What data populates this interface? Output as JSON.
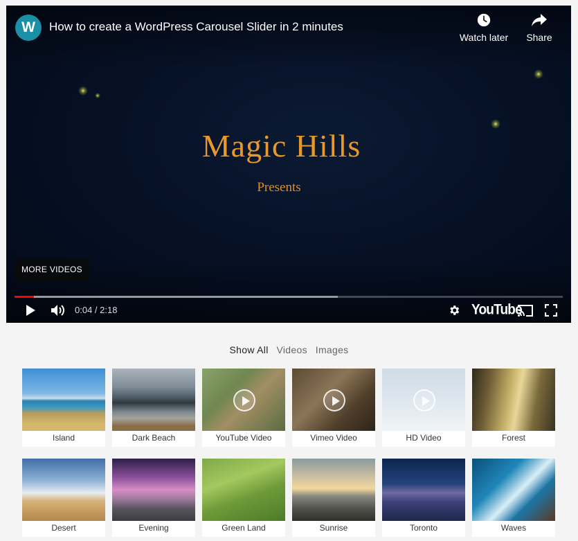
{
  "player": {
    "channel_initial": "W",
    "title": "How to create a WordPress Carousel Slider in 2 minutes",
    "watch_later_label": "Watch later",
    "share_label": "Share",
    "brand_title": "Magic Hills",
    "brand_subtitle": "Presents",
    "more_videos_label": "MORE VIDEOS",
    "time": "0:04 / 2:18",
    "progress_played_fraction": 0.035,
    "progress_loaded_fraction": 0.59,
    "platform_logo": "YouTube"
  },
  "filters": {
    "items": [
      {
        "label": "Show All",
        "active": true
      },
      {
        "label": "Videos",
        "active": false
      },
      {
        "label": "Images",
        "active": false
      }
    ]
  },
  "gallery": {
    "items": [
      {
        "caption": "Island",
        "type": "image"
      },
      {
        "caption": "Dark Beach",
        "type": "image"
      },
      {
        "caption": "YouTube Video",
        "type": "video"
      },
      {
        "caption": "Vimeo Video",
        "type": "video"
      },
      {
        "caption": "HD Video",
        "type": "video"
      },
      {
        "caption": "Forest",
        "type": "image"
      },
      {
        "caption": "Desert",
        "type": "image"
      },
      {
        "caption": "Evening",
        "type": "image"
      },
      {
        "caption": "Green Land",
        "type": "image"
      },
      {
        "caption": "Sunrise",
        "type": "image"
      },
      {
        "caption": "Toronto",
        "type": "image"
      },
      {
        "caption": "Waves",
        "type": "image"
      }
    ]
  },
  "colors": {
    "accent_red": "#ff0000",
    "brand_gold": "#e8982a",
    "avatar_teal": "#1a8fa6"
  },
  "icons": {
    "watch_later": "clock-icon",
    "share": "share-arrow-icon",
    "play": "play-icon",
    "volume": "volume-icon",
    "settings": "gear-icon",
    "cast": "cast-icon",
    "fullscreen": "fullscreen-icon"
  }
}
